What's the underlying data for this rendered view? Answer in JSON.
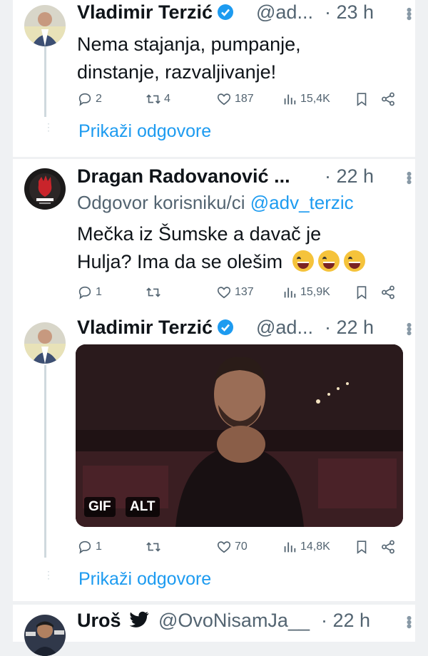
{
  "tweets": [
    {
      "author": "Vladimir Terzić",
      "verified": true,
      "handle": "@ad...",
      "time": "· 23 h",
      "text_lines": [
        "Nema stajanja, pumpanje,",
        "dinstanje, razvaljivanje!"
      ],
      "stats": {
        "replies": "2",
        "retweets": "4",
        "likes": "187",
        "views": "15,4K"
      },
      "show_replies": "Prikaži odgovore"
    },
    {
      "author": "Dragan Radovanović ...",
      "time": "· 22 h",
      "reply_prefix": "Odgovor korisniku/ci",
      "reply_mention": "@adv_terzic",
      "text_lines": [
        "Mečka iz Šumske a davač je",
        "Hulja? Ima da se olešim"
      ],
      "stats": {
        "replies": "1",
        "retweets": "",
        "likes": "137",
        "views": "15,9K"
      }
    },
    {
      "author": "Vladimir Terzić",
      "verified": true,
      "handle": "@ad...",
      "time": "· 22 h",
      "media": {
        "gif_label": "GIF",
        "alt_label": "ALT"
      },
      "stats": {
        "replies": "1",
        "retweets": "",
        "likes": "70",
        "views": "14,8K"
      },
      "show_replies": "Prikaži odgovore"
    },
    {
      "author": "Uroš",
      "handle": "@OvoNisamJa__",
      "time": "· 22 h"
    }
  ],
  "colors": {
    "accent": "#1d9bf0",
    "muted": "#536471",
    "background": "#eff1f3"
  },
  "icons": [
    "reply-icon",
    "retweet-icon",
    "like-icon",
    "views-icon",
    "bookmark-icon",
    "share-icon",
    "verified-icon",
    "more-icon",
    "bird-icon"
  ]
}
